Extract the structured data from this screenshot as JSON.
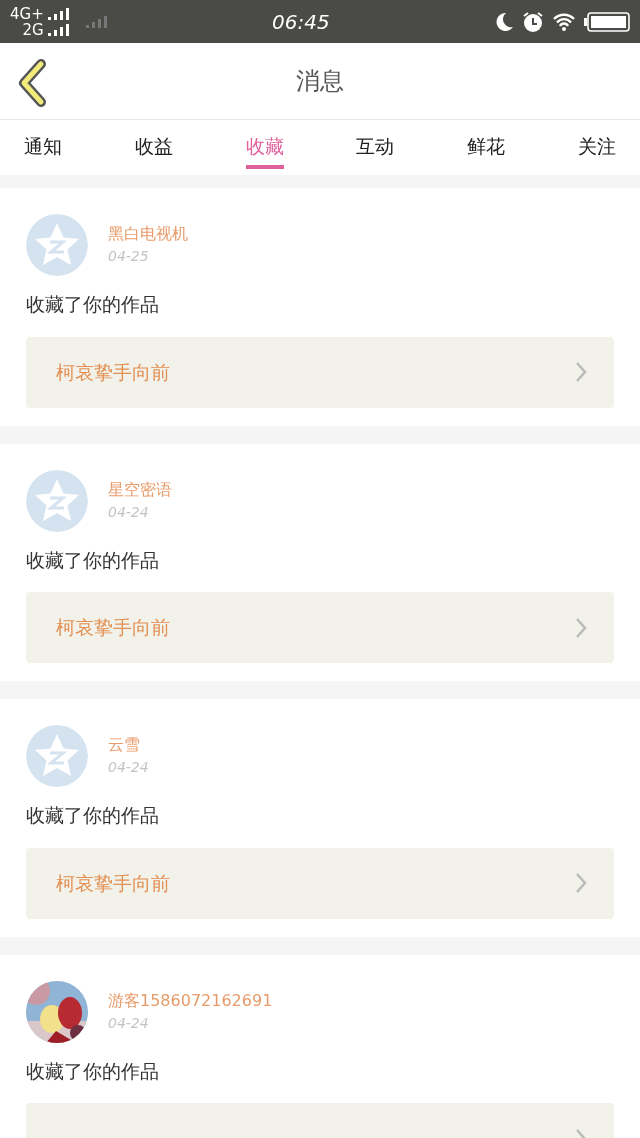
{
  "status_bar": {
    "network_1": "4G+",
    "network_2": "2G",
    "time": "06:45"
  },
  "header": {
    "title": "消息"
  },
  "tabs": [
    {
      "label": "通知",
      "selected": false
    },
    {
      "label": "收益",
      "selected": false
    },
    {
      "label": "收藏",
      "selected": true
    },
    {
      "label": "互动",
      "selected": false
    },
    {
      "label": "鲜花",
      "selected": false
    },
    {
      "label": "关注",
      "selected": false
    }
  ],
  "messages": [
    {
      "avatar": {
        "kind": "default"
      },
      "name": "黑白电视机",
      "date": "04-25",
      "action": "收藏了你的作品",
      "work": "柯哀挚手向前"
    },
    {
      "avatar": {
        "kind": "default"
      },
      "name": "星空密语",
      "date": "04-24",
      "action": "收藏了你的作品",
      "work": "柯哀挚手向前"
    },
    {
      "avatar": {
        "kind": "default"
      },
      "name": "云雪",
      "date": "04-24",
      "action": "收藏了你的作品",
      "work": "柯哀挚手向前"
    },
    {
      "name": "游客1586072162691",
      "date": "04-24",
      "action": "收藏了你的作品"
    }
  ]
}
